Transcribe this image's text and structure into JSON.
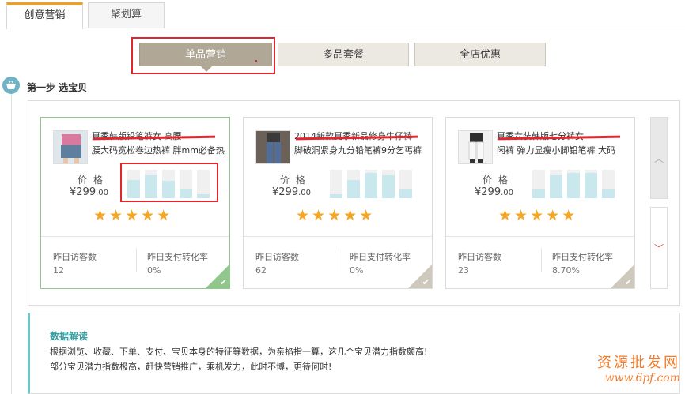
{
  "top_tabs": [
    {
      "label": "创意营销",
      "active": true
    },
    {
      "label": "聚划算",
      "active": false
    }
  ],
  "sub_tabs": [
    {
      "label": "单品营销",
      "active": true
    },
    {
      "label": "多品套餐",
      "active": false
    },
    {
      "label": "全店优惠",
      "active": false
    }
  ],
  "step": {
    "icon": "basket-icon",
    "title": "第一步 选宝贝"
  },
  "price_label": "价 格",
  "stars": "★★★★★",
  "stats_labels": {
    "visitors": "昨日访客数",
    "conversion": "昨日支付转化率"
  },
  "cards": [
    {
      "title_line1": "夏季韩版铅笔裤女 高腰",
      "title_line2": "腰大码宽松卷边热裤 胖mm必备热",
      "price": "¥299",
      "price_decimal": ".00",
      "bars": [
        0.65,
        0.8,
        0.6,
        0.3,
        0.15
      ],
      "visitors": "12",
      "conversion": "0%",
      "selected": true
    },
    {
      "title_line1": "2014新款夏季新品修身牛仔裤",
      "title_line2": "脚破洞紧身九分铅笔裤9分乞丐裤",
      "price": "¥299",
      "price_decimal": ".00",
      "bars": [
        0.15,
        0.65,
        0.9,
        0.8,
        0.3
      ],
      "visitors": "62",
      "conversion": "0%",
      "selected": false
    },
    {
      "title_line1": "夏季女装韩版七分裤女",
      "title_line2": "闲裤 弹力显瘦小脚铅笔裤 大码",
      "price": "¥299",
      "price_decimal": ".00",
      "bars": [
        0.3,
        0.8,
        0.9,
        0.9,
        0.3
      ],
      "visitors": "23",
      "conversion": "8.70%",
      "selected": false
    }
  ],
  "scroll": {
    "up_icon": "chevron-up-icon",
    "down_icon": "chevron-down-icon"
  },
  "notes": {
    "title": "数据解读",
    "line1": "根据浏览、收藏、下单、支付、宝贝本身的特征等数据，为亲掐指一算，这几个宝贝潜力指数颇高!",
    "line2": "部分宝贝潜力指数极高，赶快营销推广，乘机发力，此时不博，更待何时!"
  },
  "watermark": {
    "line1": "资源批发网",
    "line2": "www.6pf.com"
  },
  "colors": {
    "accent": "#f0a01e",
    "selected_border": "#8fc78d",
    "bar": "#c8e8ed",
    "star": "#f5a623",
    "highlight": "#e3262d"
  }
}
